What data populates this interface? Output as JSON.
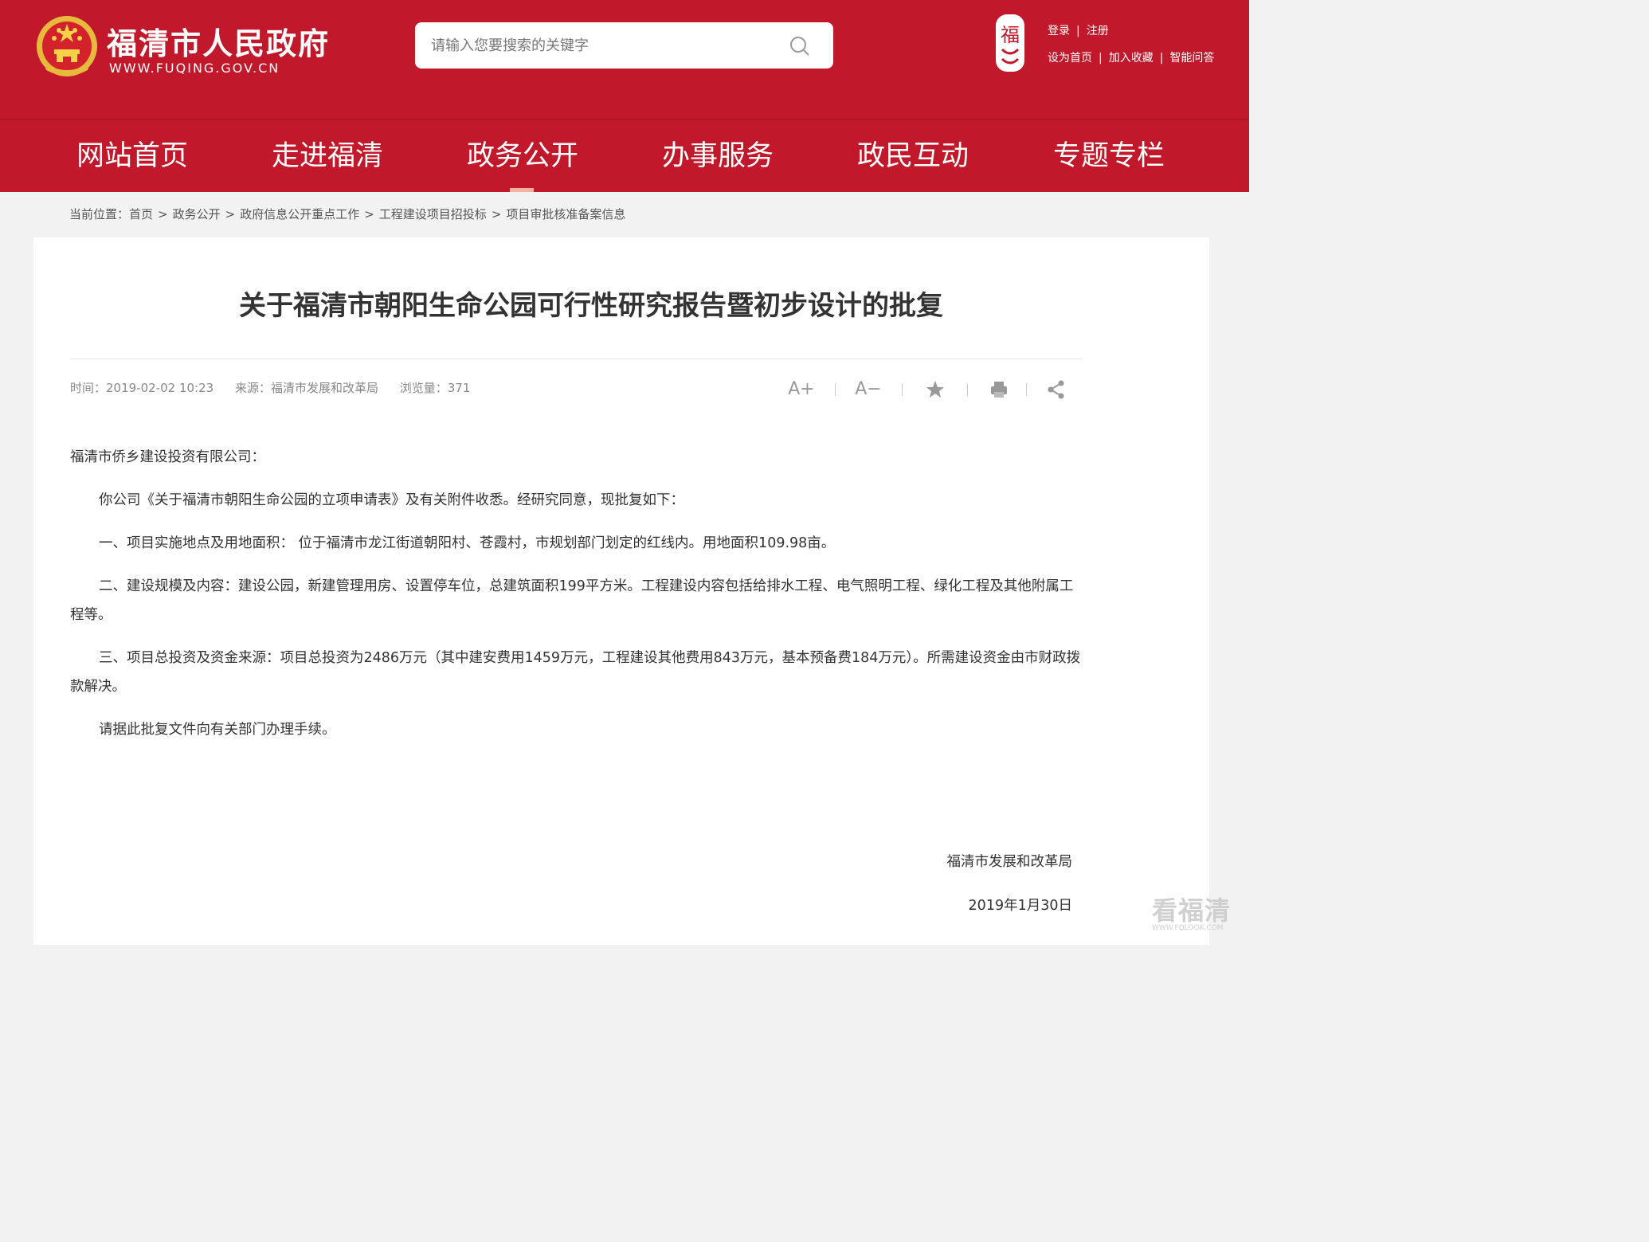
{
  "header": {
    "site_title": "福清市人民政府",
    "site_url": "WWW.FUQING.GOV.CN",
    "search_placeholder": "请输入您要搜索的关键字",
    "seal_text": "福",
    "user_links": {
      "login": "登录",
      "register": "注册",
      "set_homepage": "设为首页",
      "add_favorite": "加入收藏",
      "smart_qa": "智能问答"
    }
  },
  "nav": {
    "items": [
      "网站首页",
      "走进福清",
      "政务公开",
      "办事服务",
      "政民互动",
      "专题专栏"
    ],
    "active_index": 2
  },
  "breadcrumb": {
    "label": "当前位置：",
    "items": [
      "首页",
      "政务公开",
      "政府信息公开重点工作",
      "工程建设项目招投标",
      "项目审批核准备案信息"
    ]
  },
  "article": {
    "title": "关于福清市朝阳生命公园可行性研究报告暨初步设计的批复",
    "meta": {
      "time": "时间：2019-02-02 10:23",
      "source": "来源：福清市发展和改革局",
      "views": "浏览量：371"
    },
    "tools": {
      "font_larger": "A+",
      "font_smaller": "A−"
    },
    "paragraphs": [
      "福清市侨乡建设投资有限公司：",
      "你公司《关于福清市朝阳生命公园的立项申请表》及有关附件收悉。经研究同意，现批复如下：",
      "一、项目实施地点及用地面积： 位于福清市龙江街道朝阳村、苍霞村，市规划部门划定的红线内。用地面积109.98亩。",
      "二、建设规模及内容：建设公园，新建管理用房、设置停车位，总建筑面积199平方米。工程建设内容包括给排水工程、电气照明工程、绿化工程及其他附属工程等。",
      "三、项目总投资及资金来源：项目总投资为2486万元（其中建安费用1459万元，工程建设其他费用843万元，基本预备费184万元）。所需建设资金由市财政拨款解决。",
      "请据此批复文件向有关部门办理手续。"
    ],
    "signature": "福清市发展和改革局",
    "date": "2019年1月30日"
  },
  "watermark": {
    "text": "看福清",
    "sub": "WWW.FQLOOK.COM"
  }
}
